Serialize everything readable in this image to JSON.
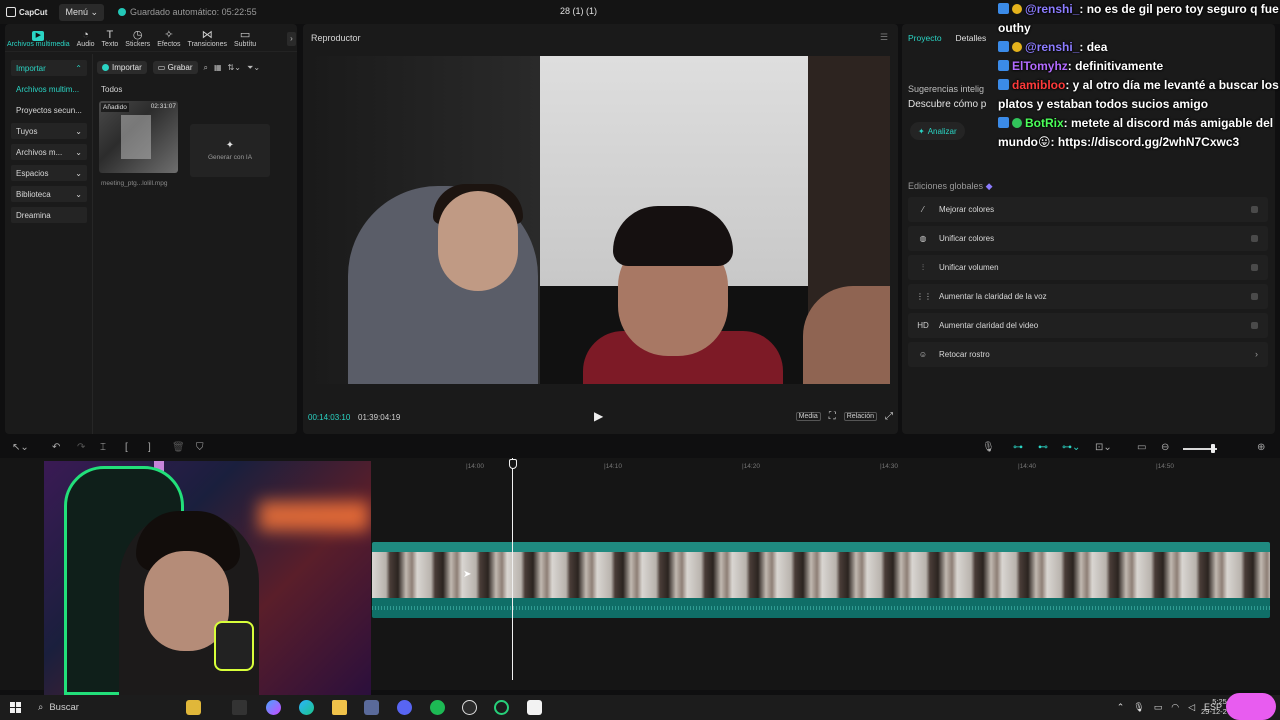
{
  "topbar": {
    "logo": "CapCut",
    "menu_label": "Menú",
    "autosave": "Guardado automático: 05:22:55",
    "project_title": "28 (1) (1)"
  },
  "media_tabs": [
    {
      "label": "Archivos multimedia",
      "icon": "media-icon"
    },
    {
      "label": "Audio",
      "icon": "audio-icon"
    },
    {
      "label": "Texto",
      "icon": "text-icon"
    },
    {
      "label": "Stickers",
      "icon": "sticker-icon"
    },
    {
      "label": "Efectos",
      "icon": "effects-icon"
    },
    {
      "label": "Transiciones",
      "icon": "transitions-icon"
    },
    {
      "label": "Subtítu",
      "icon": "subtitles-icon"
    }
  ],
  "sidenav": {
    "import": "Importar",
    "media": "Archivos multim...",
    "projects": "Proyectos secun...",
    "yours": "Tuyos",
    "media2": "Archivos m...",
    "spaces": "Espacios",
    "library": "Biblioteca",
    "dreamina": "Dreamina"
  },
  "media_toolbar": {
    "import": "Importar",
    "record": "Grabar"
  },
  "media": {
    "section": "Todos",
    "clip_badge": "Añadido",
    "clip_duration": "02:31:07",
    "clip_name": "meeting_ptg...lolill.mpg",
    "generate_ai": "Generar con IA"
  },
  "player": {
    "title": "Reproductor",
    "current_time": "00:14:03:10",
    "total_time": "01:39:04:19",
    "media_chip": "Media",
    "ratio_chip": "Relación"
  },
  "right_panel": {
    "tab_project": "Proyecto",
    "tab_details": "Detalles",
    "suggest_title": "Sugerencias intelig",
    "suggest_desc": "Descubre cómo p",
    "analyze": "Analizar",
    "global_title": "Ediciones globales",
    "global_items": [
      {
        "label": "Mejorar colores",
        "icon": "magic-wand-icon",
        "trail": "toggle"
      },
      {
        "label": "Unificar colores",
        "icon": "color-match-icon",
        "trail": "toggle"
      },
      {
        "label": "Unificar volumen",
        "icon": "volume-sliders-icon",
        "trail": "toggle"
      },
      {
        "label": "Aumentar la claridad de la voz",
        "icon": "voice-wave-icon",
        "trail": "toggle"
      },
      {
        "label": "Aumentar claridad del video",
        "icon": "hd-icon",
        "trail": "toggle"
      },
      {
        "label": "Retocar rostro",
        "icon": "face-retouch-icon",
        "trail": "chevron"
      }
    ]
  },
  "chat": [
    {
      "user": "@renshi_",
      "color": "#8c7cff",
      "text": ": no es de gil pero toy seguro q fue outhy"
    },
    {
      "user": "@renshi_",
      "color": "#8c7cff",
      "text": ": dea"
    },
    {
      "user": "ElTomyhz",
      "color": "#b36bff",
      "text": ": definitivamente"
    },
    {
      "user": "damibloo",
      "color": "#ff3b3b",
      "text": ": y al otro día me levanté a buscar los platos y estaban todos sucios amigo"
    },
    {
      "user": "BotRix",
      "color": "#4cff5a",
      "text": ": metete al discord más amigable del mundo😛: https://discord.gg/2whN7Cxwc3"
    }
  ],
  "timeline": {
    "ruler": [
      "|14:00",
      "|14:10",
      "|14:20",
      "|14:30",
      "|14:40",
      "|14:50"
    ]
  },
  "taskbar": {
    "search": "Buscar",
    "lang": "ESP",
    "time": "5:25",
    "date": "29-12-2"
  }
}
